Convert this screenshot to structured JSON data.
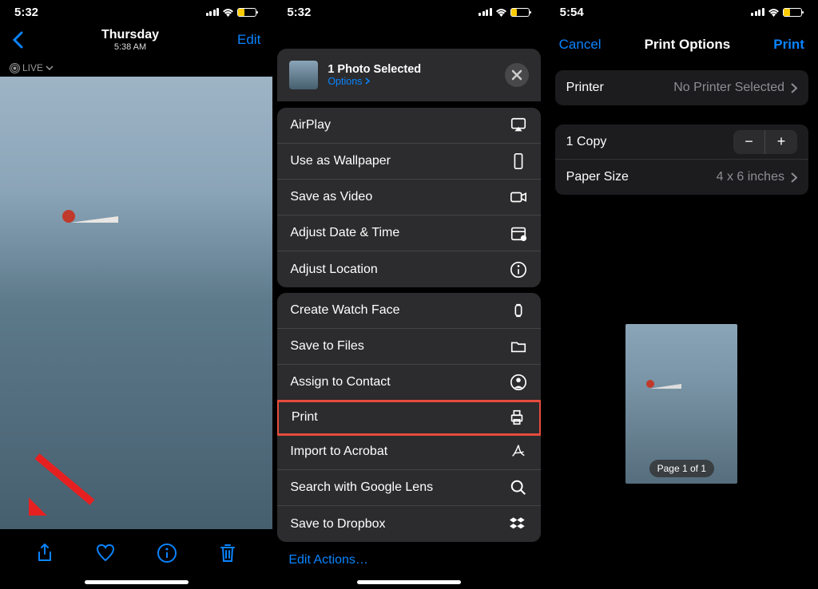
{
  "panel1": {
    "status": {
      "time": "5:32"
    },
    "nav": {
      "day": "Thursday",
      "time": "5:38 AM",
      "edit": "Edit"
    },
    "live": "LIVE"
  },
  "panel2": {
    "status": {
      "time": "5:32"
    },
    "header": {
      "title": "1 Photo Selected",
      "options": "Options"
    },
    "group1": [
      {
        "label": "AirPlay",
        "icon": "airplay-icon"
      },
      {
        "label": "Use as Wallpaper",
        "icon": "phone-icon"
      },
      {
        "label": "Save as Video",
        "icon": "video-icon"
      },
      {
        "label": "Adjust Date & Time",
        "icon": "calendar-icon"
      },
      {
        "label": "Adjust Location",
        "icon": "info-icon"
      }
    ],
    "group2": [
      {
        "label": "Create Watch Face",
        "icon": "watch-icon"
      },
      {
        "label": "Save to Files",
        "icon": "folder-icon"
      },
      {
        "label": "Assign to Contact",
        "icon": "contact-icon"
      },
      {
        "label": "Print",
        "icon": "print-icon",
        "highlight": true
      },
      {
        "label": "Import to Acrobat",
        "icon": "acrobat-icon"
      },
      {
        "label": "Search with Google Lens",
        "icon": "search-icon"
      },
      {
        "label": "Save to Dropbox",
        "icon": "dropbox-icon"
      }
    ],
    "editActions": "Edit Actions…"
  },
  "panel3": {
    "status": {
      "time": "5:54"
    },
    "nav": {
      "cancel": "Cancel",
      "title": "Print Options",
      "print": "Print"
    },
    "printer": {
      "label": "Printer",
      "value": "No Printer Selected"
    },
    "copies": {
      "label": "1 Copy"
    },
    "paper": {
      "label": "Paper Size",
      "value": "4 x 6 inches"
    },
    "pageInfo": "Page 1 of 1"
  }
}
